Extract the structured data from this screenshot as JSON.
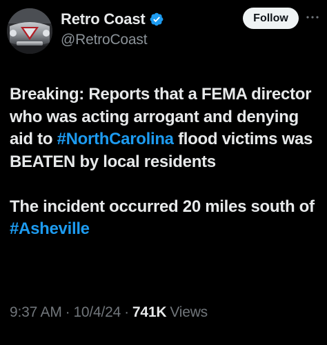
{
  "author": {
    "display_name": "Retro Coast",
    "handle": "@RetroCoast",
    "verified": true
  },
  "follow_button": {
    "label": "Follow"
  },
  "more_icon": "more-horizontal-icon",
  "tweet": {
    "paragraph_1": {
      "text_before_hashtag": "Breaking: Reports that a FEMA director who was acting arrogant and denying aid to ",
      "hashtag": "#NorthCarolina",
      "text_after_hashtag": " flood victims was BEATEN by local residents"
    },
    "paragraph_2": {
      "text_before_hashtag": "The incident occurred 20 miles south of ",
      "hashtag": "#Asheville"
    }
  },
  "meta": {
    "time": "9:37 AM",
    "separator": "·",
    "date": "10/4/24",
    "views_count": "741K",
    "views_label": "Views"
  },
  "colors": {
    "background": "#000000",
    "text": "#e7e9ea",
    "secondary": "#71767b",
    "link": "#1d9bf0",
    "verified": "#1d9bf0",
    "follow_bg": "#eff3f4"
  }
}
